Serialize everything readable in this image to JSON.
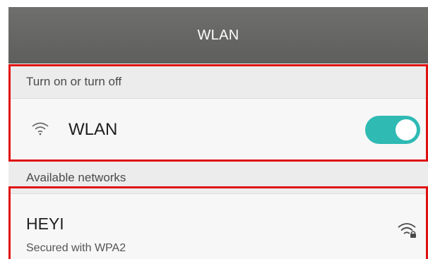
{
  "header": {
    "title": "WLAN"
  },
  "sections": {
    "toggle_header": "Turn on or turn off",
    "networks_header": "Available networks"
  },
  "wlan_row": {
    "label": "WLAN",
    "icon": "wifi-icon",
    "toggle_on": true,
    "toggle_color": "#2fbab4"
  },
  "networks": [
    {
      "name": "HEYI",
      "security": "Secured with WPA2",
      "icon": "wifi-lock-icon"
    }
  ],
  "highlight_color": "#e01010"
}
